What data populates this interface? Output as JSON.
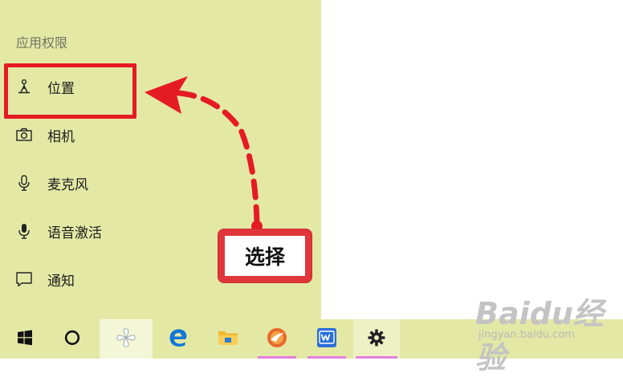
{
  "section_title": "应用权限",
  "nav": {
    "items": [
      {
        "label": "位置",
        "icon": "location-icon"
      },
      {
        "label": "相机",
        "icon": "camera-icon"
      },
      {
        "label": "麦克风",
        "icon": "microphone-icon"
      },
      {
        "label": "语音激活",
        "icon": "voice-activation-icon"
      },
      {
        "label": "通知",
        "icon": "notification-icon"
      }
    ]
  },
  "annotation": {
    "label": "选择",
    "color": "#e51b24"
  },
  "taskbar": {
    "items": [
      {
        "icon": "windows-start-icon"
      },
      {
        "icon": "cortana-search-icon"
      },
      {
        "icon": "pinwheel-app-icon"
      },
      {
        "icon": "edge-browser-icon"
      },
      {
        "icon": "file-explorer-icon"
      },
      {
        "icon": "orange-browser-icon"
      },
      {
        "icon": "wps-office-icon"
      },
      {
        "icon": "settings-gear-icon"
      }
    ]
  },
  "watermark": {
    "logo": "Baidu经验",
    "url": "jingyan.baidu.com"
  }
}
